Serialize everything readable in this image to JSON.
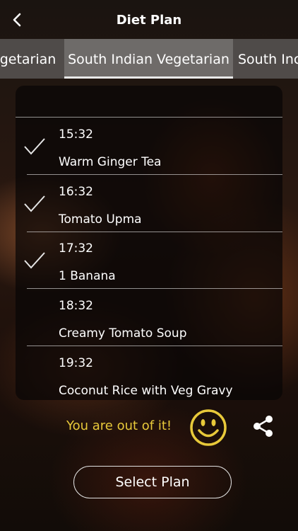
{
  "header": {
    "title": "Diet Plan"
  },
  "tabs": [
    {
      "label": "Vegetarian",
      "visible_text": "egetarian"
    },
    {
      "label": "South Indian Vegetarian"
    },
    {
      "label": "South Ind",
      "visible_text": "South Inc"
    }
  ],
  "meals": [
    {
      "time": "15:32",
      "name": "Warm Ginger Tea",
      "checked": true
    },
    {
      "time": "16:32",
      "name": "Tomato Upma",
      "checked": true
    },
    {
      "time": "17:32",
      "name": "1 Banana",
      "checked": true
    },
    {
      "time": "18:32",
      "name": "Creamy Tomato Soup",
      "checked": false
    },
    {
      "time": "19:32",
      "name": "Coconut Rice with Veg Gravy",
      "checked": false
    }
  ],
  "status": {
    "message": "You are out of it!",
    "icon": "smiley-icon"
  },
  "actions": {
    "select_plan_label": "Select Plan",
    "share_icon": "share-icon"
  },
  "colors": {
    "accent_yellow": "#e8c93a"
  }
}
